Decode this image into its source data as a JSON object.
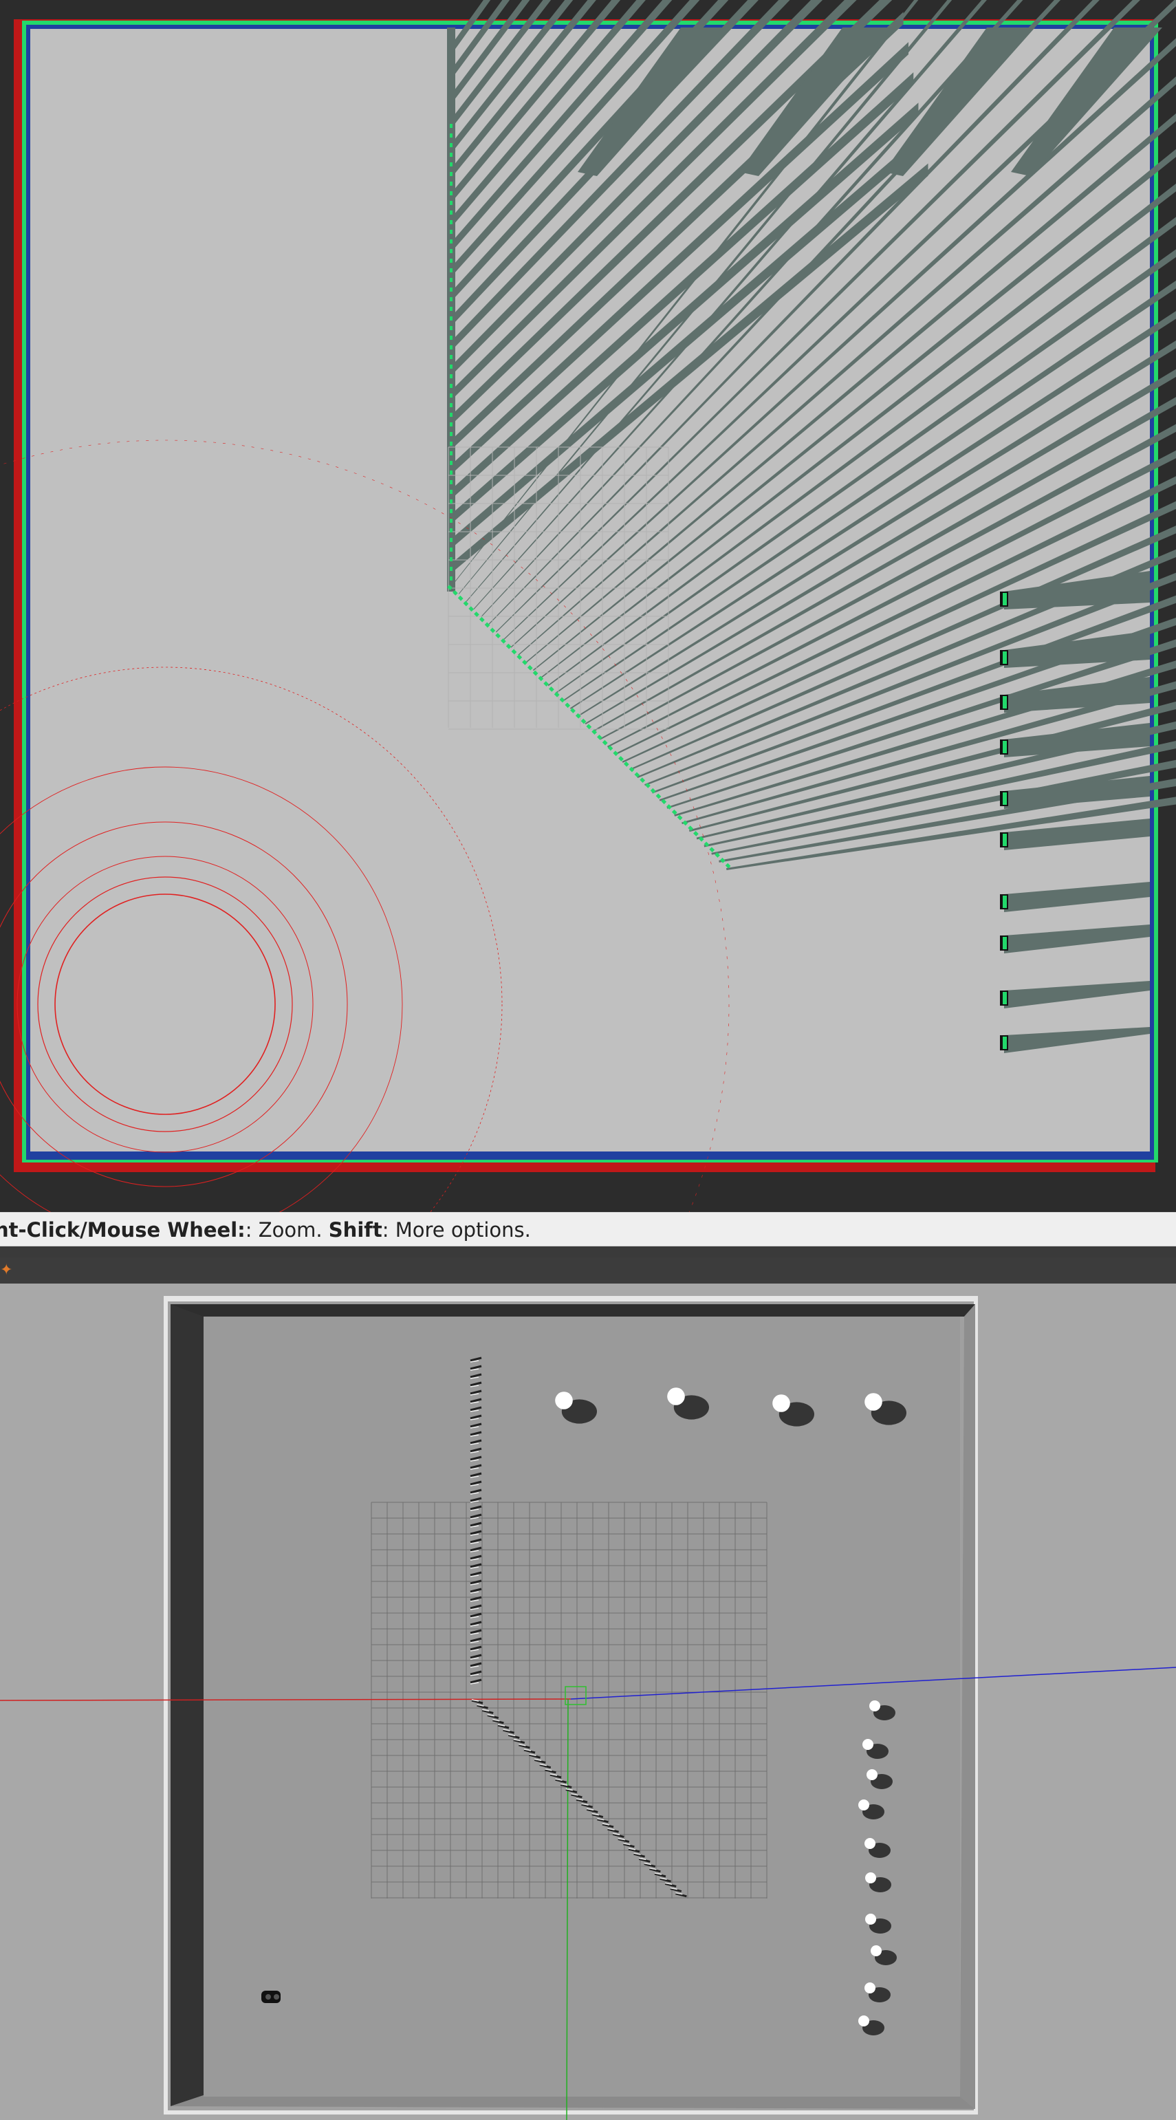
{
  "status_bar": {
    "segments": [
      {
        "text": "ht-Click/Mouse Wheel:",
        "bold": true
      },
      {
        "text": ": Zoom. ",
        "bold": false
      },
      {
        "text": "Shift",
        "bold": true
      },
      {
        "text": ": More options.",
        "bold": false
      }
    ]
  },
  "gazebo_toolbar": {
    "icon": "tool-icon"
  },
  "colors": {
    "rviz_background": "#2c2c2c",
    "map_free": "#c0c0c0",
    "map_occupied": "#5f706c",
    "costmap_edge": "#23d86b",
    "laser_scan": "#e02020",
    "gazebo_floor": "#9a9a9a",
    "gazebo_wall": "#3a3a3a",
    "axis_x": "#d02020",
    "axis_y": "#20b020",
    "axis_z": "#2020d0"
  }
}
